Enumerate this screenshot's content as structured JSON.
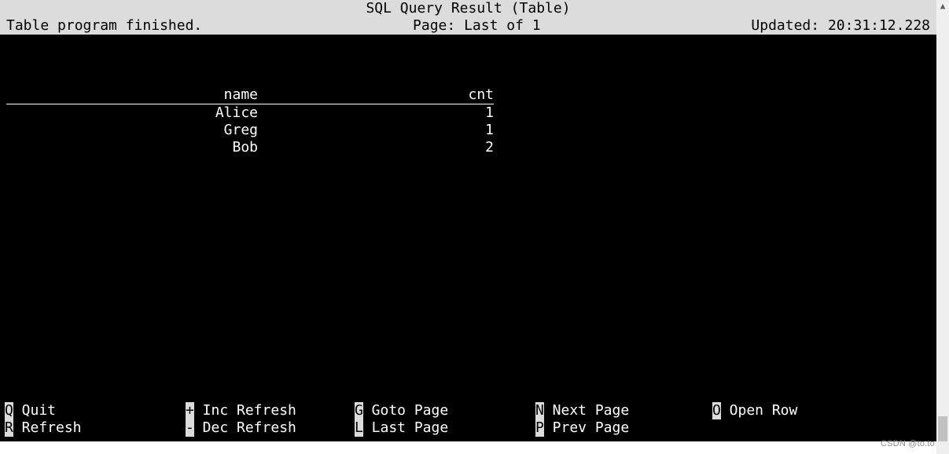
{
  "header": {
    "title": "SQL Query Result (Table)",
    "status_left": "Table program finished.",
    "page_label": "Page:",
    "page_value": "Last of 1",
    "updated_label": "Updated:",
    "updated_value": "20:31:12.228"
  },
  "table": {
    "columns": [
      "name",
      "cnt"
    ],
    "rows": [
      {
        "name": "Alice",
        "cnt": "1"
      },
      {
        "name": "Greg",
        "cnt": "1"
      },
      {
        "name": "Bob",
        "cnt": "2"
      }
    ]
  },
  "hotkeys": {
    "row1": [
      {
        "key": "Q",
        "label": "Quit"
      },
      {
        "key": "+",
        "label": "Inc Refresh"
      },
      {
        "key": "G",
        "label": "Goto Page"
      },
      {
        "key": "N",
        "label": "Next Page"
      },
      {
        "key": "O",
        "label": "Open Row"
      }
    ],
    "row2": [
      {
        "key": "R",
        "label": "Refresh"
      },
      {
        "key": "-",
        "label": "Dec Refresh"
      },
      {
        "key": "L",
        "label": "Last Page"
      },
      {
        "key": "P",
        "label": "Prev Page"
      }
    ]
  },
  "watermark": "CSDN @to.to"
}
